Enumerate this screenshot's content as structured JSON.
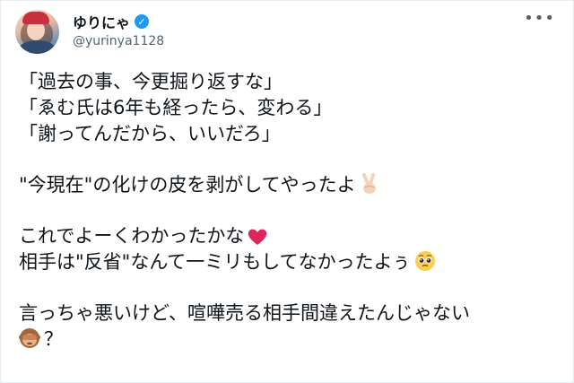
{
  "user": {
    "display_name": "ゆりにゃ",
    "handle": "@yurinya1128",
    "verified_mark": "✓"
  },
  "menu": {
    "more_label": "•••"
  },
  "tweet": {
    "lines": [
      "「過去の事、今更掘り返すな」",
      "「ゑむ氏は6年も経ったら、変わる」",
      "「謝ってんだから、いいだろ」",
      "\"今現在\"の化けの皮を剥がしてやったよ",
      "これでよーくわかったかな",
      "相手は\"反省\"なんて一ミリもしてなかったよぅ",
      "言っちゃ悪いけど、喧嘩売る相手間違えたんじゃない",
      "？"
    ]
  },
  "icons": {
    "avatar": "profile-avatar",
    "verified": "verified-badge-icon",
    "more": "more-options-icon",
    "victory_hand": "victory-hand-emoji",
    "heart": "red-heart-emoji",
    "pleading_face": "pleading-face-emoji",
    "monkey": "see-no-evil-monkey-emoji"
  },
  "colors": {
    "accent": "#1d9bf0",
    "text": "#0f1419",
    "secondary": "#536471",
    "heart": "#e0245e"
  }
}
